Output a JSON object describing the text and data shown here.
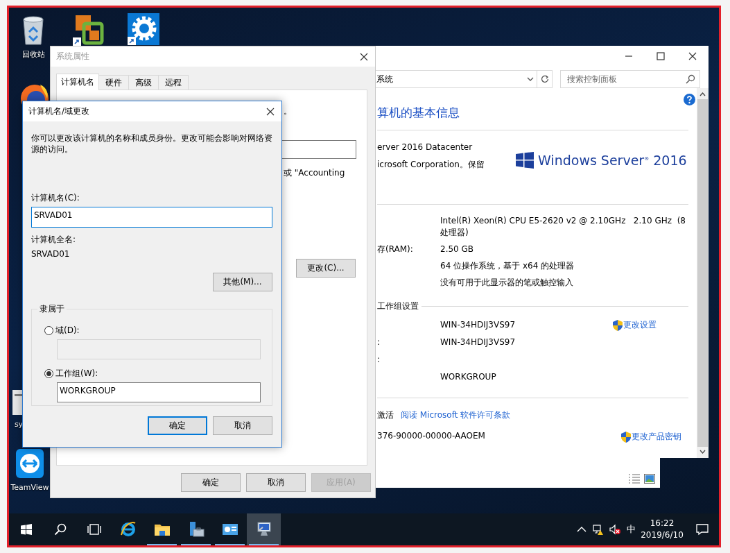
{
  "desktop_icons": [
    {
      "kind": "recycle",
      "label": "回收站"
    },
    {
      "kind": "app"
    },
    {
      "kind": "settings"
    },
    {
      "kind": "browser"
    },
    {
      "kind": "document",
      "label": "sy"
    },
    {
      "kind": "remote",
      "label": "TeamView"
    }
  ],
  "control_panel": {
    "address": "系统",
    "search": {
      "placeholder": "搜索控制面板"
    },
    "heading": "算机的基本信息",
    "edition": [
      "erver 2016 Datacenter",
      "icrosoft Corporation。保留"
    ],
    "logo": "Windows Server$^{®}$ 2016",
    "system": [
      {
        "value": "Intel(R) Xeon(R) CPU E5-2620 v2 @ 2.10GHz   2.10 GHz  (8 处理器)"
      },
      {
        "label": "存(RAM):",
        "value": "2.50 GB"
      },
      {
        "value": "64 位操作系统，基于 x64 的处理器"
      },
      {
        "value": "没有可用于此显示器的笔或触控输入"
      }
    ],
    "workgroup_title": "工作组设置",
    "workgroup": [
      {
        "value": "WIN-34HDIJ3VS97",
        "link": "更改设置"
      },
      {
        "label": ":",
        "value": "WIN-34HDIJ3VS97"
      },
      {
        "label": ":"
      },
      {
        "value": "WORKGROUP"
      }
    ],
    "activation": {
      "status": "激活",
      "license_link": "阅读 Microsoft 软件许可条款",
      "product_id": "376-90000-00000-AAOEM",
      "key_link": "更改产品密钥"
    }
  },
  "props_dialog": {
    "title": "系统属性",
    "tabs": [
      {
        "label": "计算机名",
        "selected": true
      },
      {
        "label": "硬件",
        "selected": false
      },
      {
        "label": "高级",
        "selected": false
      },
      {
        "label": "远程",
        "selected": false
      }
    ],
    "partial_text": "。",
    "example_text": "或 \"Accounting",
    "change_button": "更改(C)...",
    "buttons": [
      {
        "label": "确定",
        "disabled": false
      },
      {
        "label": "取消",
        "disabled": false
      },
      {
        "label": "应用(A)",
        "disabled": true
      }
    ]
  },
  "name_dialog": {
    "title": "计算机名/域更改",
    "intro": "你可以更改该计算机的名称和成员身份。更改可能会影响对网络资源的访问。",
    "name_label": "计算机名(C):",
    "name_value": "SRVAD01",
    "full_label": "计算机全名:",
    "full_value": "SRVAD01",
    "more_button": "其他(M)...",
    "member_of": "隶属于",
    "options": [
      {
        "label": "域(D):",
        "selected": false
      },
      {
        "label": "工作组(W):",
        "selected": true,
        "value": "WORKGROUP"
      }
    ],
    "buttons": [
      {
        "label": "确定",
        "default": true
      },
      {
        "label": "取消",
        "default": false
      }
    ]
  },
  "taskbar": {
    "apps": [
      {
        "kind": "ie",
        "running": false,
        "selected": false
      },
      {
        "kind": "folder",
        "running": true,
        "selected": false
      },
      {
        "kind": "server",
        "running": true,
        "selected": false
      },
      {
        "kind": "panel",
        "running": true,
        "selected": false
      },
      {
        "kind": "monitor",
        "running": true,
        "selected": true
      }
    ],
    "ime": "中",
    "time": "16:22",
    "date": "2019/6/10"
  }
}
